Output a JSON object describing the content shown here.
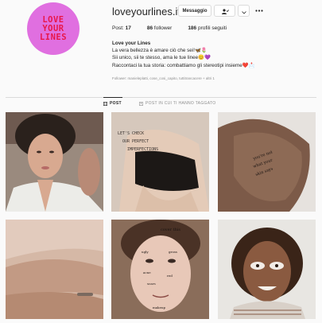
{
  "profile": {
    "username": "loveyourlines.it",
    "avatar_text_1": "LOVE",
    "avatar_text_2": "YOUR",
    "avatar_text_3": "LINES",
    "message_button": "Messaggio"
  },
  "stats": {
    "posts_count": "17",
    "posts_label": "Post:",
    "followers_count": "86",
    "followers_label": "follower",
    "following_count": "186",
    "following_label": "profili seguiti"
  },
  "bio": {
    "name": "Love your Lines",
    "line1": "La vera bellezza è amare ciò che sei!🦋🌷",
    "line2": "Sii unico, sii te stesso, ama le tue linee😊💜",
    "line3": "Raccontaci la tua storia: combattiamo gli stereotipi insieme❤️📩"
  },
  "followed_by": "Follower: manieleplatti, cose_cosi_capito, tuttitrancacere + altri 1",
  "tabs": {
    "posts": "POST",
    "tagged": "POST IN CUI TI HANNO TAGGATO"
  },
  "posts": [
    {
      "caption": ""
    },
    {
      "caption": "LET'S CHECK FOR PERFECT IMPERFECTIONS"
    },
    {
      "caption": "you're not what your skin says you are"
    },
    {
      "caption": ""
    },
    {
      "caption": "cover this"
    },
    {
      "caption": ""
    }
  ]
}
